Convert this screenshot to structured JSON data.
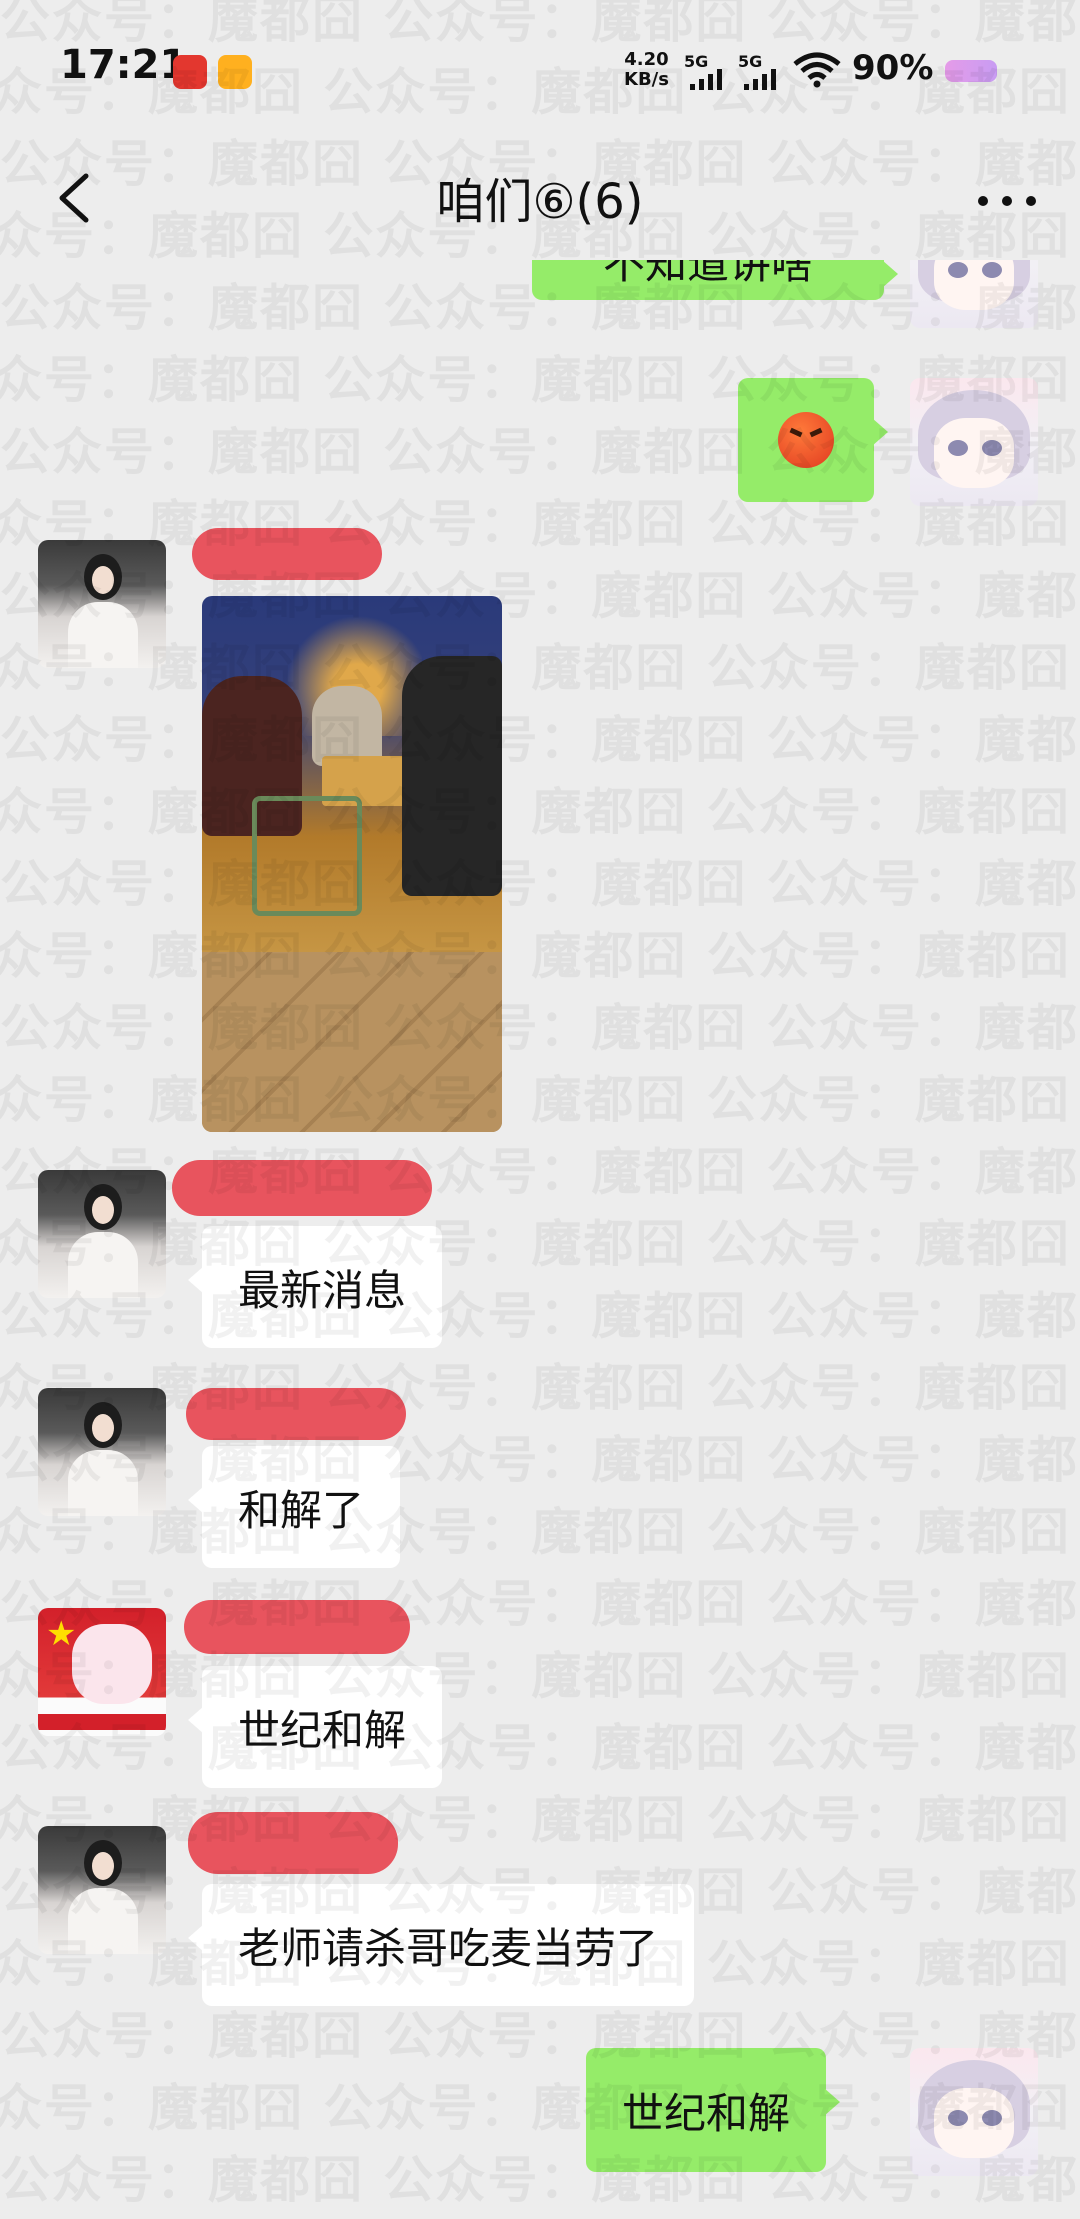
{
  "status_bar": {
    "time": "17:21",
    "net_speed_value": "4.20",
    "net_speed_unit": "KB/s",
    "sim1_label": "5G",
    "sim2_label": "5G",
    "battery_pct": "90%"
  },
  "header": {
    "title": "咱们⑥(6)"
  },
  "messages": [
    {
      "side": "out",
      "kind": "text",
      "text": "不知道讲啥"
    },
    {
      "side": "out",
      "kind": "emoji",
      "emoji": "angry-face-icon"
    },
    {
      "side": "in",
      "kind": "image",
      "sender": "[redacted]"
    },
    {
      "side": "in",
      "kind": "text",
      "text": "最新消息",
      "sender": "[redacted]"
    },
    {
      "side": "in",
      "kind": "text",
      "text": "和解了",
      "sender": "[redacted]"
    },
    {
      "side": "in",
      "kind": "text",
      "text": "世纪和解",
      "sender": "[redacted]"
    },
    {
      "side": "in",
      "kind": "text",
      "text": "老师请杀哥吃麦当劳了",
      "sender": "[redacted]"
    },
    {
      "side": "out",
      "kind": "text",
      "text": "世纪和解"
    }
  ],
  "watermark": {
    "text": "公众号：魔都囧"
  },
  "colors": {
    "background": "#ededed",
    "bubble_out": "#95ec69",
    "bubble_in": "#ffffff",
    "redaction": "#e8545e"
  }
}
